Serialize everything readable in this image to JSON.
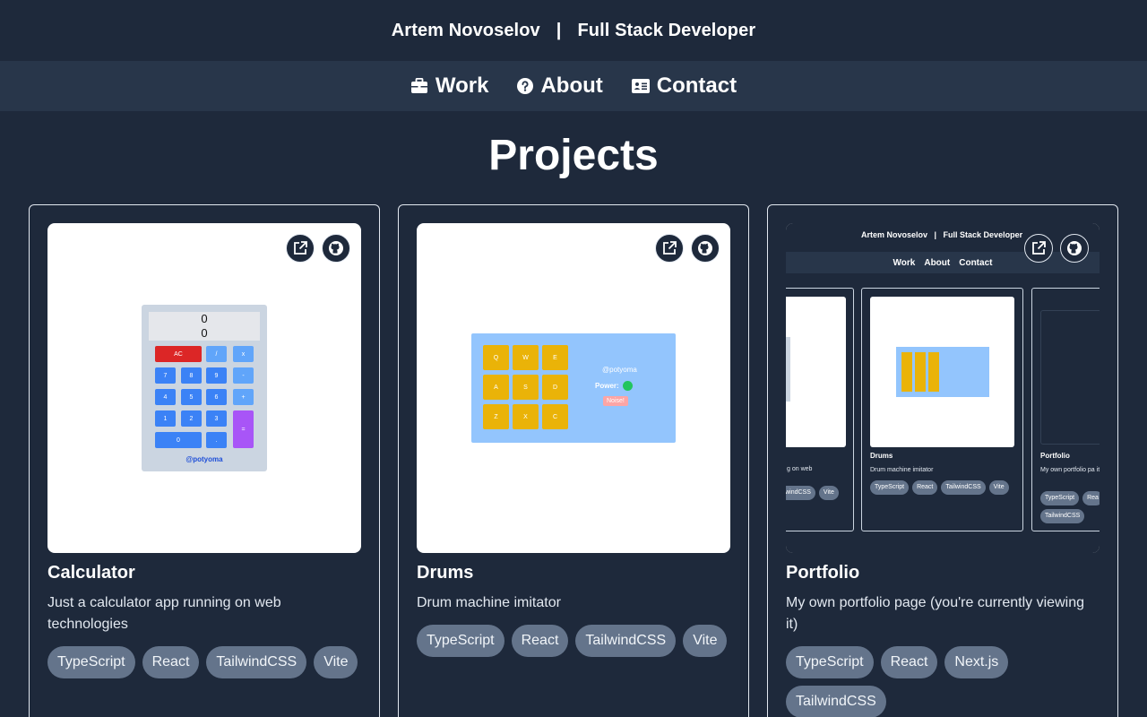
{
  "header": {
    "name": "Artem Novoselov",
    "separator": "|",
    "role": "Full Stack Developer"
  },
  "nav": [
    {
      "label": "Work",
      "icon": "briefcase-icon"
    },
    {
      "label": "About",
      "icon": "question-circle-icon"
    },
    {
      "label": "Contact",
      "icon": "id-card-icon"
    }
  ],
  "page_title": "Projects",
  "projects": [
    {
      "title": "Calculator",
      "description": "Just a calculator app running on web technologies",
      "tags": [
        "TypeScript",
        "React",
        "TailwindCSS",
        "Vite"
      ],
      "preview": {
        "display_top": "0",
        "display_bottom": "0",
        "keys": [
          "AC",
          "/",
          "x",
          "7",
          "8",
          "9",
          "-",
          "4",
          "5",
          "6",
          "+",
          "1",
          "2",
          "3",
          "=",
          "0",
          "."
        ],
        "signature": "@potyoma"
      }
    },
    {
      "title": "Drums",
      "description": "Drum machine imitator",
      "tags": [
        "TypeScript",
        "React",
        "TailwindCSS",
        "Vite"
      ],
      "preview": {
        "pads": [
          "Q",
          "W",
          "E",
          "A",
          "S",
          "D",
          "Z",
          "X",
          "C"
        ],
        "signature": "@potyoma",
        "power_label": "Power:",
        "noise_button": "Noise!"
      }
    },
    {
      "title": "Portfolio",
      "description": "My own portfolio page (you're currently viewing it)",
      "tags": [
        "TypeScript",
        "React",
        "Next.js",
        "TailwindCSS"
      ],
      "preview": {
        "header": "Artem Novoselov   |   Full Stack Developer",
        "nav": [
          "Work",
          "About",
          "Contact"
        ],
        "partial_desc": "g on web",
        "partial_tags": [
          "ilwindCSS",
          "Vite"
        ],
        "drums_title": "Drums",
        "drums_desc": "Drum machine imitator",
        "drums_tags": [
          "TypeScript",
          "React",
          "TailwindCSS",
          "Vite"
        ],
        "portfolio_title": "Portfolio",
        "portfolio_desc": "My own portfolio pa it)",
        "portfolio_tags": [
          "TypeScript",
          "Rea",
          "TailwindCSS"
        ]
      }
    }
  ],
  "colors": {
    "background": "#1e293b",
    "navbar": "#28364a",
    "tag": "#64748b",
    "border": "#e2e8f0"
  }
}
